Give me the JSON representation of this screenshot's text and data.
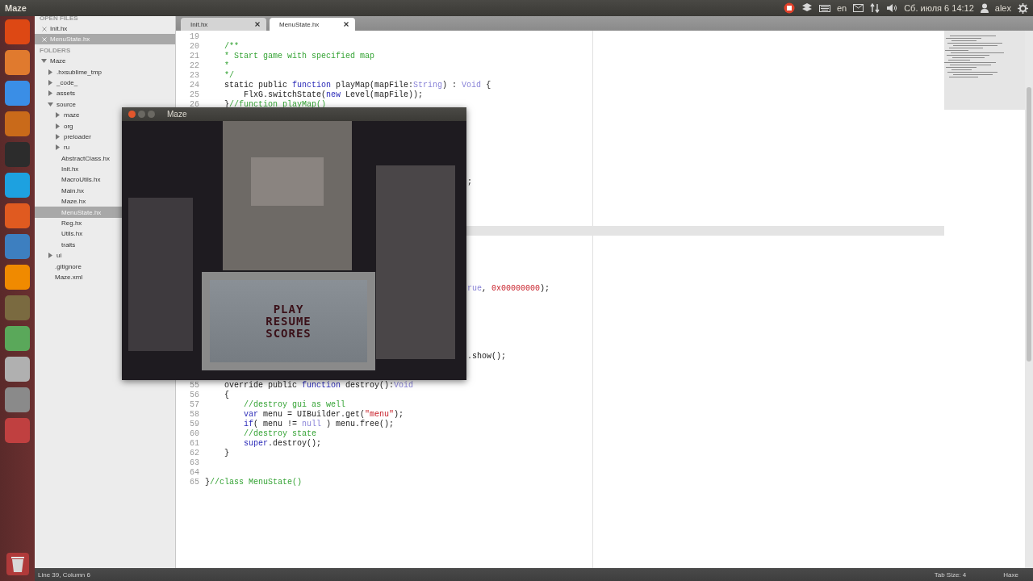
{
  "top_panel": {
    "title": "Maze",
    "keyboard_layout": "en",
    "clock": "Сб. июля 6 14:12",
    "user": "alex"
  },
  "sidebar": {
    "open_files_header": "OPEN FILES",
    "open_files": [
      {
        "name": "Init.hx",
        "selected": false
      },
      {
        "name": "MenuState.hx",
        "selected": true
      }
    ],
    "folders_header": "FOLDERS",
    "tree": [
      {
        "name": "Maze",
        "kind": "folder",
        "expanded": true,
        "selected": false,
        "children": [
          {
            "name": ".hxsublime_tmp",
            "kind": "folder",
            "expanded": false,
            "selected": false
          },
          {
            "name": "_code_",
            "kind": "folder",
            "expanded": false,
            "selected": false
          },
          {
            "name": "assets",
            "kind": "folder",
            "expanded": false,
            "selected": false
          },
          {
            "name": "source",
            "kind": "folder",
            "expanded": true,
            "selected": false,
            "children": [
              {
                "name": "maze",
                "kind": "folder",
                "expanded": false,
                "selected": false
              },
              {
                "name": "org",
                "kind": "folder",
                "expanded": false,
                "selected": false
              },
              {
                "name": "preloader",
                "kind": "folder",
                "expanded": false,
                "selected": false
              },
              {
                "name": "ru",
                "kind": "folder",
                "expanded": false,
                "selected": false
              },
              {
                "name": "AbstractClass.hx",
                "kind": "file",
                "selected": false
              },
              {
                "name": "Init.hx",
                "kind": "file",
                "selected": false
              },
              {
                "name": "MacroUtils.hx",
                "kind": "file",
                "selected": false
              },
              {
                "name": "Main.hx",
                "kind": "file",
                "selected": false
              },
              {
                "name": "Maze.hx",
                "kind": "file",
                "selected": false
              },
              {
                "name": "MenuState.hx",
                "kind": "file",
                "selected": true
              },
              {
                "name": "Reg.hx",
                "kind": "file",
                "selected": false
              },
              {
                "name": "Utils.hx",
                "kind": "file",
                "selected": false
              },
              {
                "name": "traits",
                "kind": "file",
                "selected": false
              }
            ]
          },
          {
            "name": "ui",
            "kind": "folder",
            "expanded": false,
            "selected": false
          },
          {
            "name": ".gitignore",
            "kind": "file",
            "selected": false
          },
          {
            "name": "Maze.xml",
            "kind": "file",
            "selected": false
          }
        ]
      }
    ]
  },
  "tabs": [
    {
      "label": "Init.hx",
      "selected": false
    },
    {
      "label": "MenuState.hx",
      "selected": true
    }
  ],
  "code": {
    "lines": [
      {
        "kind": "full",
        "number": "19",
        "current": false
      },
      {
        "kind": "full",
        "number": "20",
        "current": false,
        "segments": [
          {
            "text": "    /**",
            "kind": "comment"
          }
        ]
      },
      {
        "kind": "full",
        "number": "21",
        "current": false,
        "segments": [
          {
            "text": "    * Start game with specified map",
            "kind": "comment"
          }
        ]
      },
      {
        "kind": "full",
        "number": "22",
        "current": false,
        "segments": [
          {
            "text": "    *",
            "kind": "comment"
          }
        ]
      },
      {
        "kind": "full",
        "number": "23",
        "current": false,
        "segments": [
          {
            "text": "    */",
            "kind": "comment"
          }
        ]
      },
      {
        "kind": "full",
        "number": "24",
        "current": false,
        "segments": [
          {
            "text": "    static public ",
            "kind": "plain"
          },
          {
            "text": "function",
            "kind": "keyword"
          },
          {
            "text": " playMap(mapFile:",
            "kind": "plain"
          },
          {
            "text": "String",
            "kind": "type"
          },
          {
            "text": ") : ",
            "kind": "plain"
          },
          {
            "text": "Void",
            "kind": "type"
          },
          {
            "text": " {",
            "kind": "plain"
          }
        ]
      },
      {
        "kind": "full",
        "number": "25",
        "current": false,
        "segments": [
          {
            "text": "        FlxG.switchState(",
            "kind": "plain"
          },
          {
            "text": "new",
            "kind": "keyword"
          },
          {
            "text": " Level(mapFile));",
            "kind": "plain"
          }
        ]
      },
      {
        "kind": "full",
        "number": "26",
        "current": false,
        "segments": [
          {
            "text": "    }",
            "kind": "plain"
          },
          {
            "text": "//function playMap()",
            "kind": "comment"
          }
        ]
      },
      {
        "kind": "hidden",
        "current": false
      },
      {
        "kind": "hidden",
        "current": false
      },
      {
        "kind": "hidden",
        "current": false
      },
      {
        "kind": "hidden",
        "current": false
      },
      {
        "kind": "hidden",
        "current": false
      },
      {
        "kind": "hidden",
        "current": false
      },
      {
        "kind": "hidden",
        "current": false
      },
      {
        "kind": "tail",
        "current": false,
        "segments": [
          {
            "text": ";",
            "kind": "plain"
          }
        ]
      },
      {
        "kind": "hidden",
        "current": false
      },
      {
        "kind": "hidden",
        "current": false
      },
      {
        "kind": "hidden",
        "current": false
      },
      {
        "kind": "hidden",
        "current": false
      },
      {
        "kind": "hidden",
        "current": true
      },
      {
        "kind": "hidden",
        "current": false
      },
      {
        "kind": "hidden",
        "current": false
      },
      {
        "kind": "hidden",
        "current": false
      },
      {
        "kind": "hidden",
        "current": false
      },
      {
        "kind": "hidden",
        "current": false
      },
      {
        "kind": "tail",
        "current": false,
        "segments": [
          {
            "text": "rue",
            "kind": "type"
          },
          {
            "text": ", ",
            "kind": "plain"
          },
          {
            "text": "0x00000000",
            "kind": "string"
          },
          {
            "text": ");",
            "kind": "plain"
          }
        ]
      },
      {
        "kind": "hidden",
        "current": false
      },
      {
        "kind": "hidden",
        "current": false
      },
      {
        "kind": "hidden",
        "current": false
      },
      {
        "kind": "hidden",
        "current": false
      },
      {
        "kind": "hidden",
        "current": false
      },
      {
        "kind": "hidden",
        "current": false
      },
      {
        "kind": "tail",
        "current": false,
        "segments": [
          {
            "text": ".show();",
            "kind": "plain"
          }
        ]
      },
      {
        "kind": "hidden",
        "current": false
      },
      {
        "kind": "hidden",
        "current": false
      },
      {
        "kind": "full",
        "number": "55",
        "current": false,
        "segments": [
          {
            "text": "    override public ",
            "kind": "plain"
          },
          {
            "text": "function",
            "kind": "keyword"
          },
          {
            "text": " destroy():",
            "kind": "plain"
          },
          {
            "text": "Void",
            "kind": "type"
          }
        ]
      },
      {
        "kind": "full",
        "number": "56",
        "current": false,
        "segments": [
          {
            "text": "    {",
            "kind": "plain"
          }
        ]
      },
      {
        "kind": "full",
        "number": "57",
        "current": false,
        "segments": [
          {
            "text": "        //destroy gui as well",
            "kind": "comment"
          }
        ]
      },
      {
        "kind": "full",
        "number": "58",
        "current": false,
        "segments": [
          {
            "text": "        var",
            "kind": "keyword"
          },
          {
            "text": " menu = UIBuilder.get(",
            "kind": "plain"
          },
          {
            "text": "\"menu\"",
            "kind": "string"
          },
          {
            "text": ");",
            "kind": "plain"
          }
        ]
      },
      {
        "kind": "full",
        "number": "59",
        "current": false,
        "segments": [
          {
            "text": "        if",
            "kind": "keyword"
          },
          {
            "text": "( menu != ",
            "kind": "plain"
          },
          {
            "text": "null",
            "kind": "type"
          },
          {
            "text": " ) menu.free();",
            "kind": "plain"
          }
        ]
      },
      {
        "kind": "full",
        "number": "60",
        "current": false,
        "segments": [
          {
            "text": "        //destroy state",
            "kind": "comment"
          }
        ]
      },
      {
        "kind": "full",
        "number": "61",
        "current": false,
        "segments": [
          {
            "text": "        super",
            "kind": "keyword"
          },
          {
            "text": ".destroy();",
            "kind": "plain"
          }
        ]
      },
      {
        "kind": "full",
        "number": "62",
        "current": false,
        "segments": [
          {
            "text": "    }",
            "kind": "plain"
          }
        ]
      },
      {
        "kind": "full",
        "number": "63",
        "current": false
      },
      {
        "kind": "full",
        "number": "64",
        "current": false
      },
      {
        "kind": "full",
        "number": "65",
        "current": false,
        "segments": [
          {
            "text": "}",
            "kind": "plain"
          },
          {
            "text": "//class MenuState()",
            "kind": "comment"
          }
        ]
      }
    ]
  },
  "game_window": {
    "title": "Maze",
    "menu": [
      "PLAY",
      "RESUME",
      "SCORES"
    ]
  },
  "status_bar": {
    "position": "Line 39, Column 6",
    "tab_size": "Tab Size: 4",
    "syntax": "Haxe"
  }
}
